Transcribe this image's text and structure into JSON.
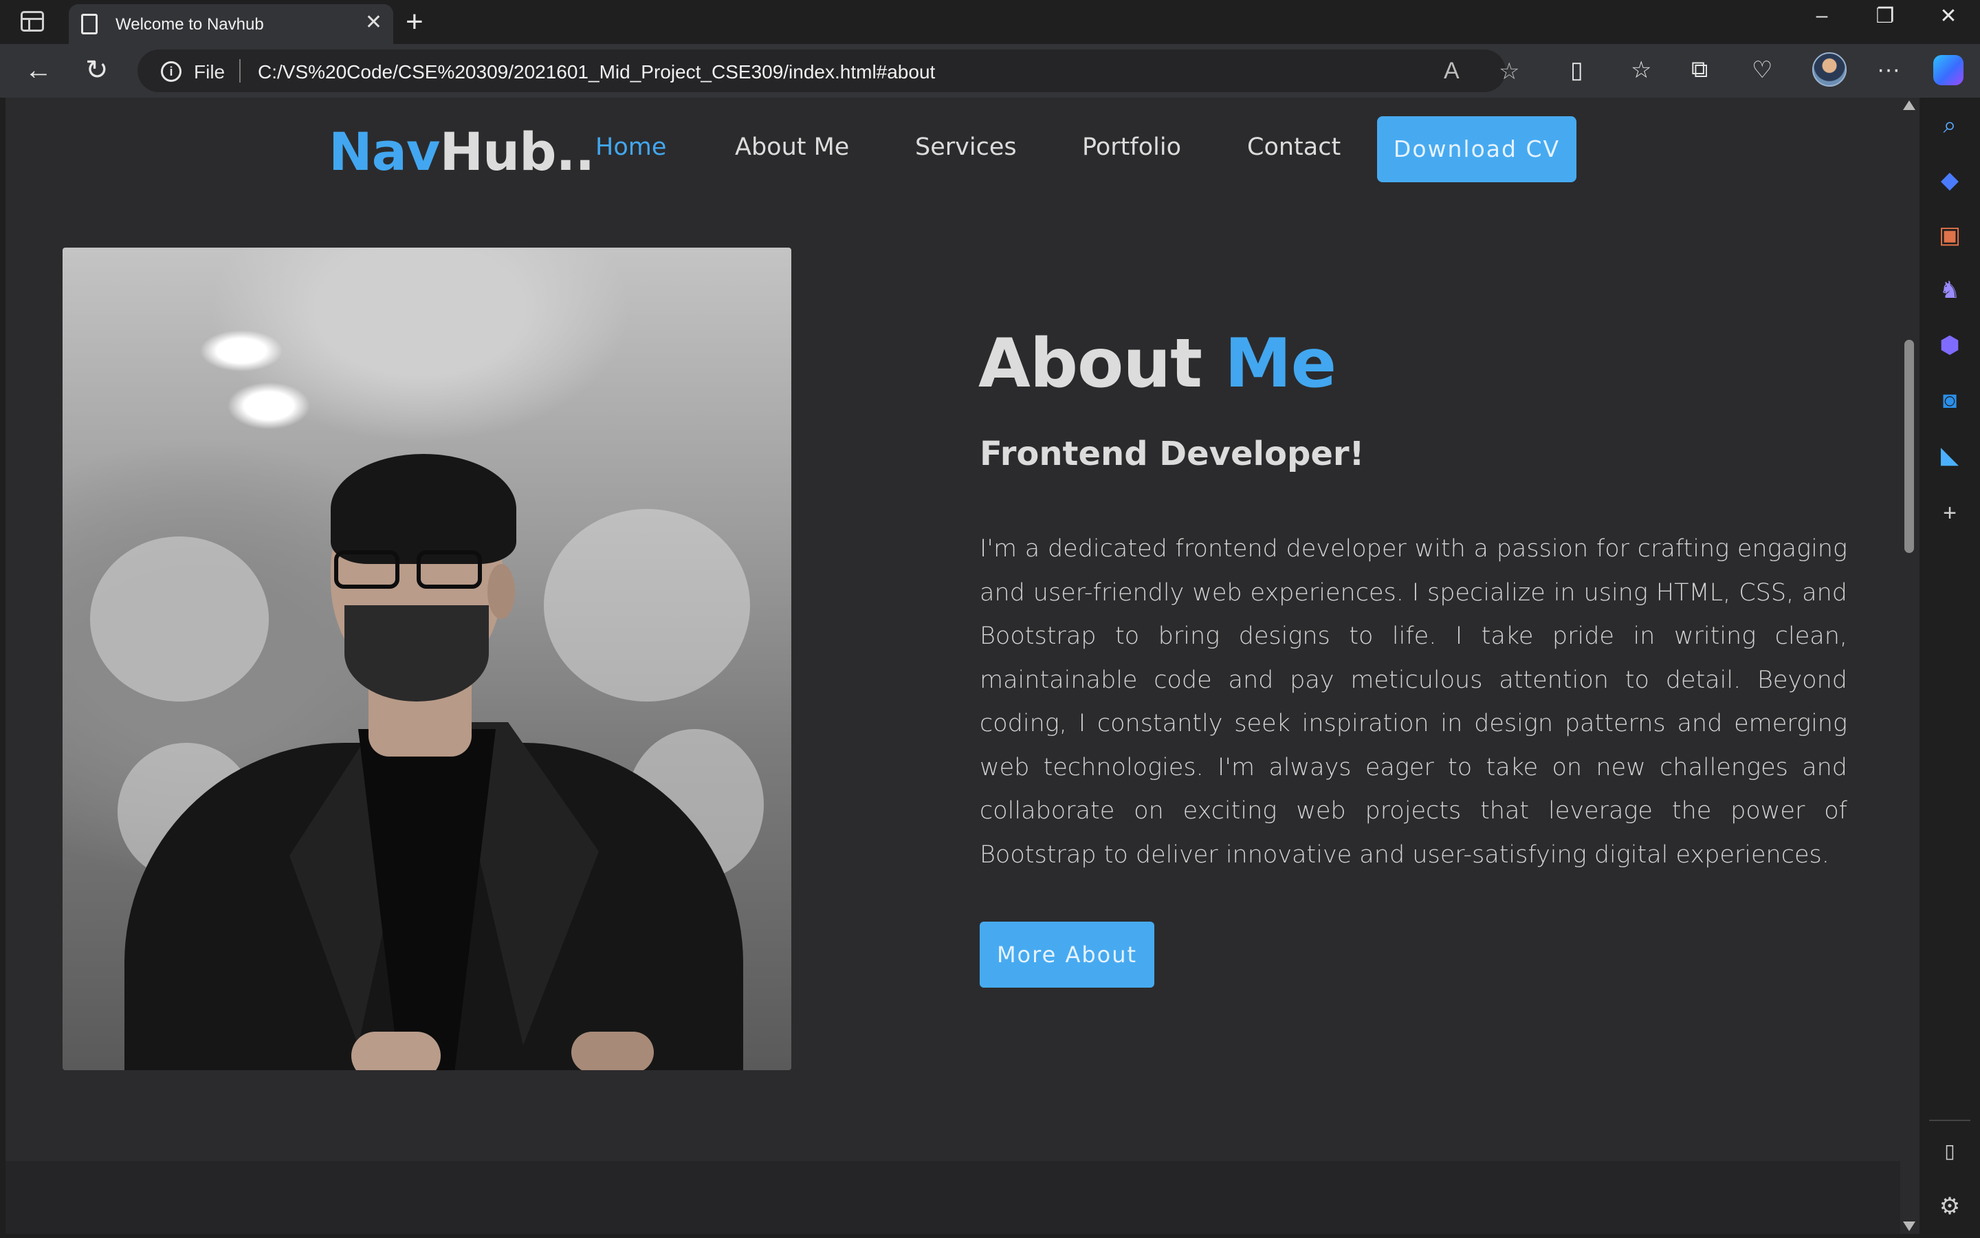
{
  "browser": {
    "tab_title": "Welcome to Navhub",
    "address_prefix": "File",
    "url": "C:/VS%20Code/CSE%20309/2021601_Mid_Project_CSE309/index.html#about"
  },
  "site": {
    "logo_part1": "Nav",
    "logo_part2": "Hub..",
    "nav": [
      {
        "label": "Home",
        "active": true
      },
      {
        "label": "About Me",
        "active": false
      },
      {
        "label": "Services",
        "active": false
      },
      {
        "label": "Portfolio",
        "active": false
      },
      {
        "label": "Contact",
        "active": false
      }
    ],
    "cta": "Download CV"
  },
  "about": {
    "title_part1": "About",
    "title_part2": "Me",
    "subtitle": "Frontend Developer!",
    "paragraph": "I'm a dedicated frontend developer with a passion for crafting engaging and user-friendly web experiences. I specialize in using HTML, CSS, and Bootstrap to bring designs to life. I take pride in writing clean, maintainable code and pay meticulous attention to detail. Beyond coding, I constantly seek inspiration in design patterns and emerging web technologies. I'm always eager to take on new challenges and collaborate on exciting web projects that leverage the power of Bootstrap to deliver innovative and user-satisfying digital experiences.",
    "button": "More About"
  },
  "colors": {
    "accent": "#42a7f0",
    "page_bg": "#2b2b2d",
    "text": "#dcdcdc"
  },
  "icons": [
    "sidebar-toggle-icon",
    "document-icon",
    "close-icon",
    "new-tab-icon",
    "minimize-icon",
    "restore-icon",
    "window-close-icon",
    "back-icon",
    "refresh-icon",
    "info-icon",
    "read-aloud-icon",
    "favorite-star-icon",
    "split-screen-icon",
    "favorites-icon",
    "collections-icon",
    "browser-essentials-icon",
    "profile-avatar",
    "more-icon",
    "copilot-icon",
    "search-icon",
    "shopping-tag-icon",
    "tools-icon",
    "games-icon",
    "microsoft-365-icon",
    "outlook-icon",
    "drop-icon",
    "add-icon",
    "hide-sidebar-icon",
    "settings-icon"
  ]
}
